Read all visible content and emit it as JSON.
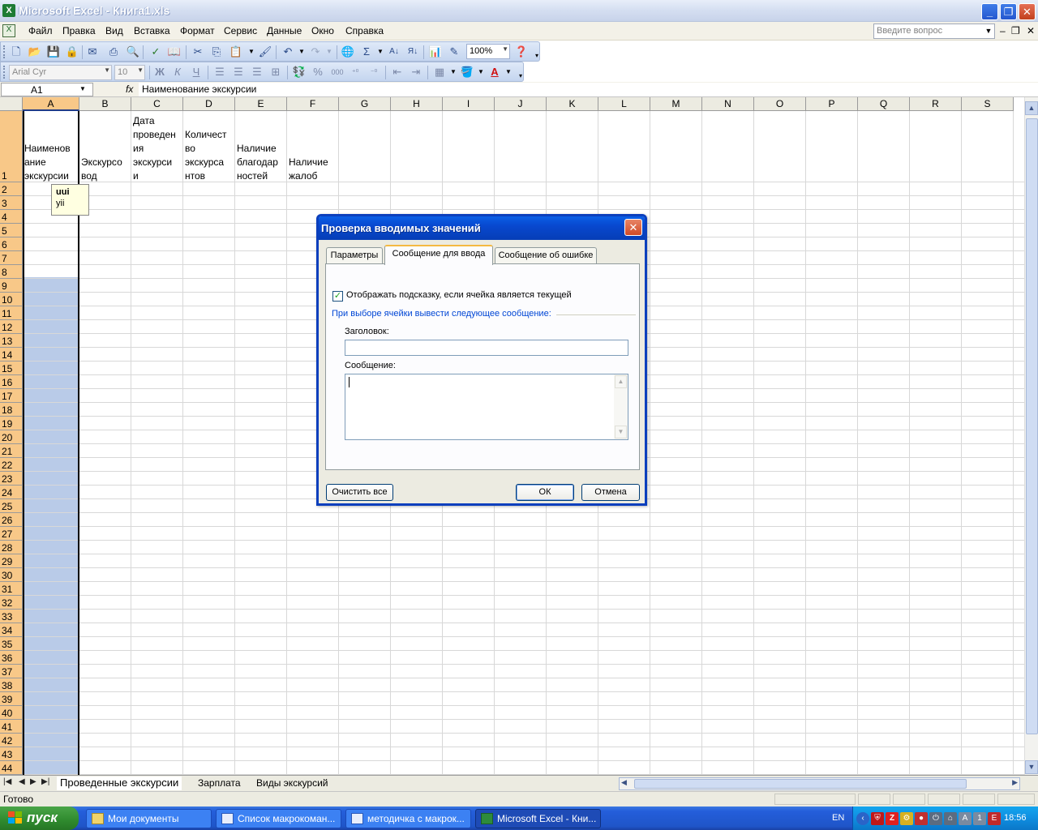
{
  "window": {
    "title": "Microsoft Excel - Книга1.xls",
    "icon": "excel-icon",
    "minimize": "_",
    "maximize": "❐",
    "close": "✕"
  },
  "menu": {
    "items": [
      "Файл",
      "Правка",
      "Вид",
      "Вставка",
      "Формат",
      "Сервис",
      "Данные",
      "Окно",
      "Справка"
    ],
    "help_placeholder": "Введите вопрос",
    "mdi_minimize": "–",
    "mdi_restore": "❐",
    "mdi_close": "✕"
  },
  "toolbar_standard": {
    "zoom": "100%"
  },
  "toolbar_formatting": {
    "font": "Arial Cyr",
    "size": "10",
    "bold": "Ж",
    "italic": "К",
    "underline": "Ч",
    "percent": "%",
    "thousands": "000",
    "font_color_glyph": "A"
  },
  "formula_bar": {
    "name_box": "A1",
    "fx": "fx",
    "formula": "Наименование экскурсии"
  },
  "sheet": {
    "columns": [
      "A",
      "B",
      "C",
      "D",
      "E",
      "F",
      "G",
      "H",
      "I",
      "J",
      "K",
      "L",
      "M",
      "N",
      "O",
      "P",
      "Q",
      "R",
      "S"
    ],
    "rows": [
      "1",
      "2",
      "3",
      "4",
      "5",
      "6",
      "7",
      "8",
      "9",
      "10",
      "11",
      "12",
      "13",
      "14",
      "15",
      "16",
      "17",
      "18",
      "19",
      "20",
      "21",
      "22",
      "23",
      "24",
      "25",
      "26",
      "27",
      "28",
      "29",
      "30",
      "31",
      "32",
      "33",
      "34",
      "35",
      "36",
      "37",
      "38",
      "39",
      "40",
      "41",
      "42",
      "43",
      "44"
    ],
    "header_cells": {
      "a": "Наименов\nание\nэкскурсии",
      "b": "Экскурсо\nвод",
      "c": "Дата\nпроведен\nия\nэкскурси\nи",
      "d": "Количест\nво\nэкскурса\nнтов",
      "e": "Наличие\nблагодар\nностей",
      "f": "Наличие\nжалоб"
    },
    "tooltip_title": "uui",
    "tooltip_text": "yii"
  },
  "sheet_tabs": {
    "tabs": [
      "Проведенные экскурсии",
      "Зарплата",
      "Виды экскурсий"
    ],
    "active": 0
  },
  "status": {
    "text": "Готово"
  },
  "taskbar": {
    "start": "пуск",
    "tasks": [
      "Мои документы",
      "Список макрокоман...",
      "методичка с макрок...",
      "Microsoft Excel - Кни..."
    ],
    "lang": "EN",
    "clock": "18:56"
  },
  "dialog": {
    "title": "Проверка вводимых значений",
    "tabs": [
      "Параметры",
      "Сообщение для ввода",
      "Сообщение об ошибке"
    ],
    "active_tab": 1,
    "checkbox_label": "Отображать подсказку, если ячейка является текущей",
    "checkbox_checked": true,
    "checkbox_mark": "✓",
    "group_label": "При выборе ячейки вывести следующее сообщение:",
    "title_label": "Заголовок:",
    "title_value": "",
    "message_label": "Сообщение:",
    "message_value": "",
    "clear_button": "Очистить все",
    "ok_button": "ОК",
    "cancel_button": "Отмена"
  },
  "colors": {
    "title_bar": "#d4def1",
    "selected_header": "#f8c888",
    "selection_fill": "#b9cbe8",
    "dialog_title": "#0848cf",
    "taskbar": "#245edb"
  }
}
